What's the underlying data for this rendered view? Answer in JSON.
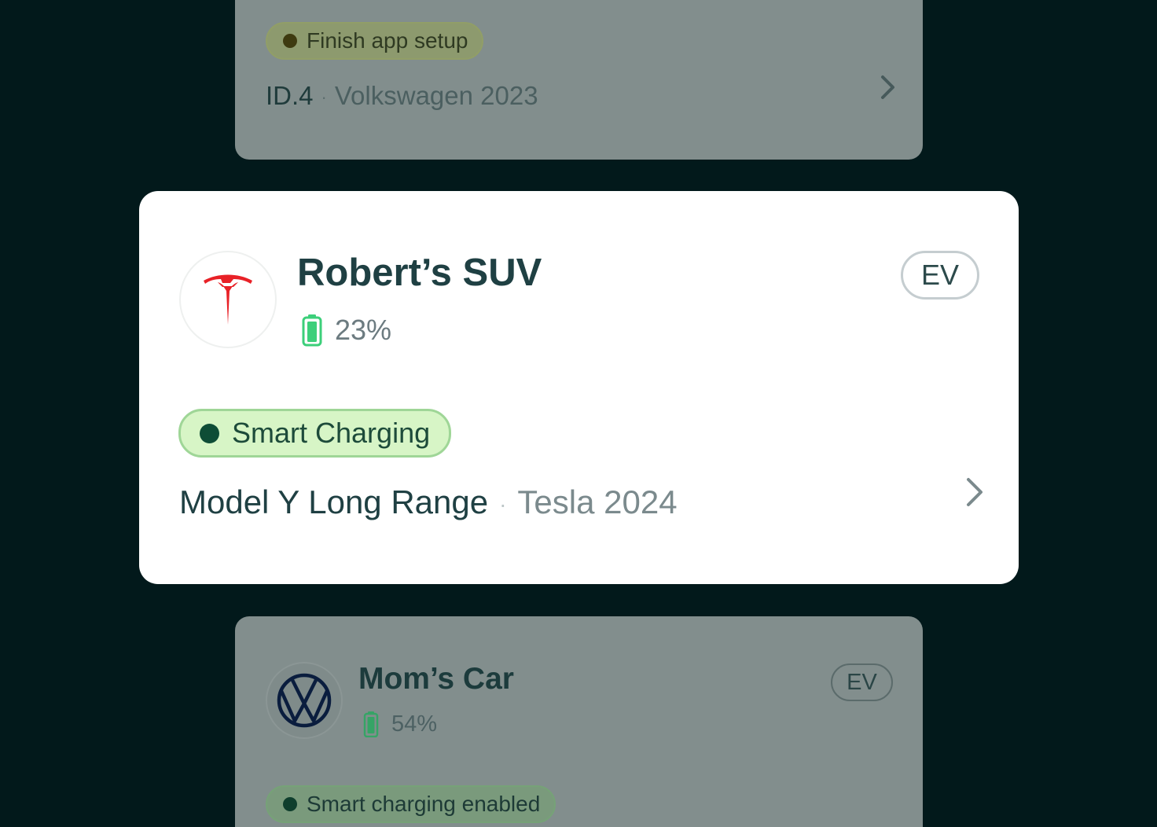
{
  "cards": [
    {
      "status_label": "Finish app setup",
      "model": "ID.4",
      "brand_year": "Volkswagen 2023"
    },
    {
      "name": "Robert’s SUV",
      "logo": "tesla-logo",
      "battery_percent": "23%",
      "battery_level": 0.23,
      "type_badge": "EV",
      "status_label": "Smart Charging",
      "model": "Model Y Long Range",
      "brand_year": "Tesla 2024"
    },
    {
      "name": "Mom’s Car",
      "logo": "volkswagen-logo",
      "battery_percent": "54%",
      "battery_level": 0.54,
      "type_badge": "EV",
      "status_label": "Smart charging enabled"
    }
  ],
  "separator": "·",
  "icons": {
    "chevron": "chevron-right-icon",
    "battery": "battery-icon"
  },
  "colors": {
    "background": "#02191b",
    "tesla_red": "#e82127",
    "battery_green": "#3ccf7a",
    "smart_charging_bg": "#d7f5c6",
    "smart_charging_dot": "#0e4d36"
  }
}
